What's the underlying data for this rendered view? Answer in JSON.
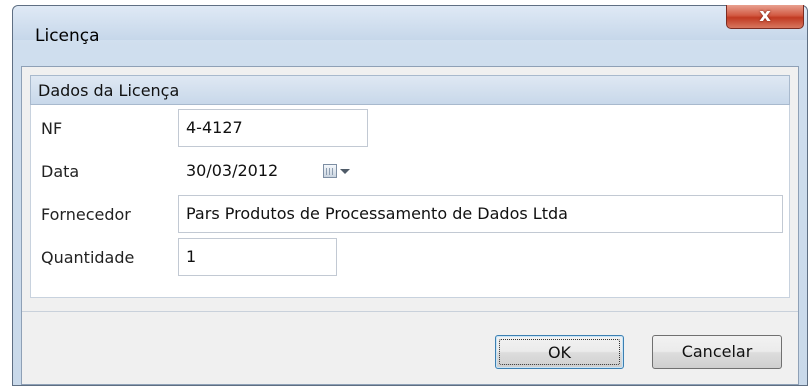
{
  "window": {
    "title": "Licença",
    "close_glyph": "x"
  },
  "group": {
    "title": "Dados da Licença"
  },
  "fields": {
    "nf": {
      "label": "NF",
      "value": "4-4127"
    },
    "data": {
      "label": "Data",
      "value": "30/03/2012"
    },
    "fornecedor": {
      "label": "Fornecedor",
      "value": "Pars Produtos de Processamento de Dados Ltda"
    },
    "quantidade": {
      "label": "Quantidade",
      "value": "1"
    }
  },
  "buttons": {
    "ok": "OK",
    "cancel": "Cancelar"
  },
  "icons": {
    "close": "close-icon",
    "calendar": "calendar-icon",
    "dropdown": "chevron-down-icon"
  },
  "colors": {
    "close_button": "#c13a22",
    "frame_border": "#5f6f83",
    "group_header": "#c8d8ea"
  }
}
